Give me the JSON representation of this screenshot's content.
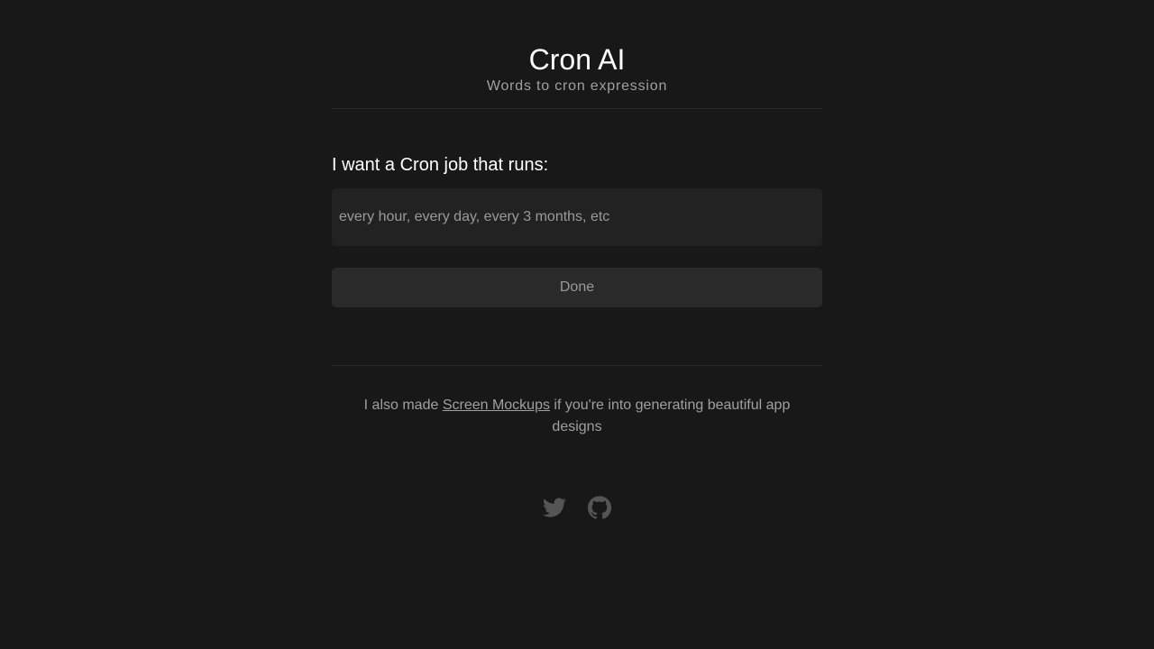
{
  "header": {
    "title": "Cron AI",
    "subtitle": "Words to cron expression"
  },
  "form": {
    "prompt_label": "I want a Cron job that runs:",
    "input_value": "",
    "input_placeholder": "every hour, every day, every 3 months, etc",
    "done_label": "Done"
  },
  "footer": {
    "promo_prefix": "I also made ",
    "promo_link": "Screen Mockups",
    "promo_suffix": " if you're into generating beautiful app designs",
    "social": [
      {
        "icon": "twitter-icon"
      },
      {
        "icon": "github-icon"
      }
    ]
  },
  "colors": {
    "background": "#181818",
    "input_background": "#222222",
    "button_background": "#2a2a2a",
    "text_primary": "#ffffff",
    "text_muted": "#a0a0a0",
    "icon": "#555555"
  }
}
